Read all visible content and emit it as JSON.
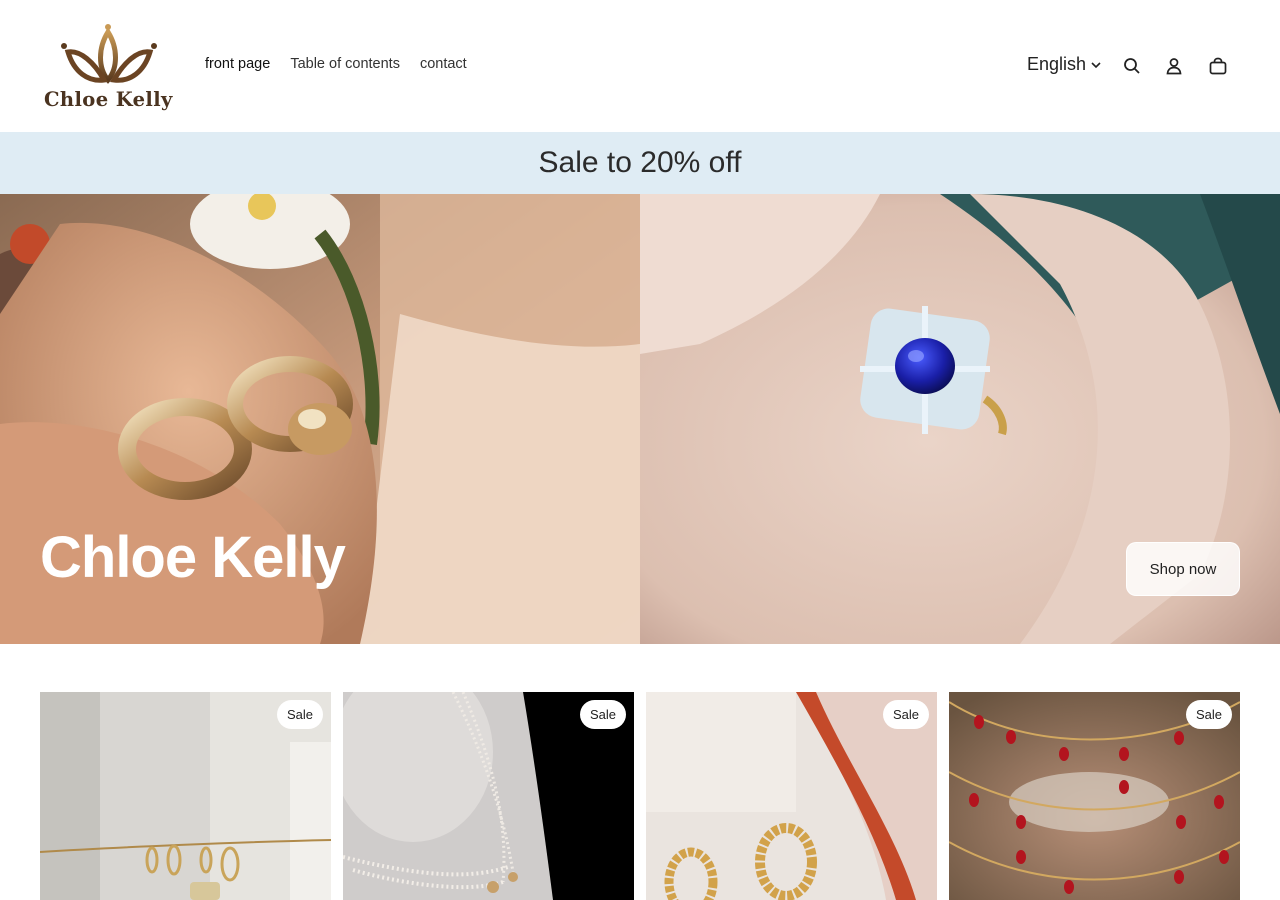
{
  "brand": {
    "name": "Chloe Kelly",
    "logo_color": "#4a3320",
    "accent": "#b8873e"
  },
  "nav": {
    "items": [
      {
        "label": "front page",
        "active": true
      },
      {
        "label": "Table of contents",
        "active": false
      },
      {
        "label": "contact",
        "active": false
      }
    ]
  },
  "header": {
    "language": "English",
    "icons": [
      "search-icon",
      "account-icon",
      "cart-icon"
    ]
  },
  "announcement": {
    "text": "Sale to 20% off",
    "background": "#dfecf4"
  },
  "hero": {
    "title": "Chloe Kelly",
    "button_label": "Shop now"
  },
  "products": [
    {
      "badge": "Sale"
    },
    {
      "badge": "Sale"
    },
    {
      "badge": "Sale"
    },
    {
      "badge": "Sale"
    }
  ]
}
